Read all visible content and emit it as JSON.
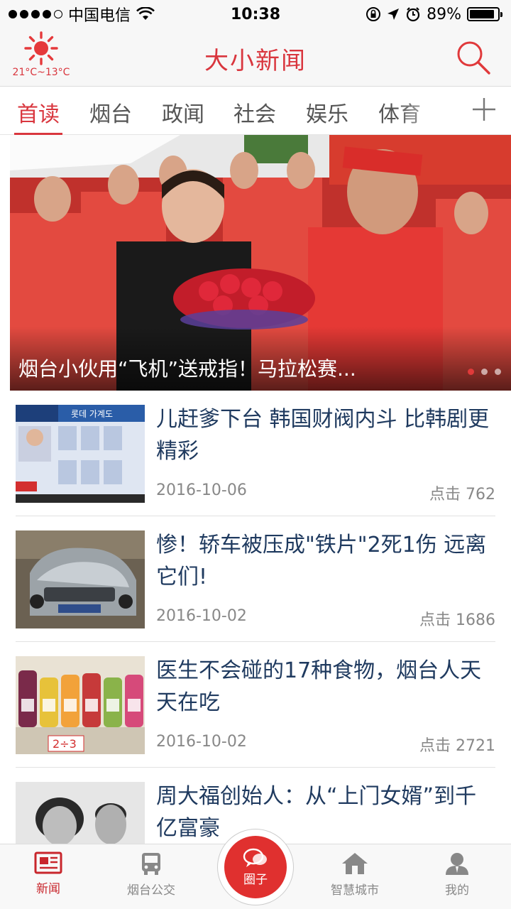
{
  "status_bar": {
    "carrier": "中国电信",
    "time": "10:38",
    "battery": "89%",
    "battery_level": 0.89
  },
  "header": {
    "title": "大小新闻",
    "weather_temp": "21°C~13°C"
  },
  "tabs": [
    {
      "label": "首读",
      "active": true
    },
    {
      "label": "烟台"
    },
    {
      "label": "政闻"
    },
    {
      "label": "社会"
    },
    {
      "label": "娱乐"
    },
    {
      "label": "体育"
    }
  ],
  "hero": {
    "caption": "烟台小伙用“飞机”送戒指！马拉松赛...",
    "slide_count": 3,
    "active_slide": 1
  },
  "news": [
    {
      "title": "儿赶爹下台 韩国财阀内斗 比韩剧更精彩",
      "date": "2016-10-06",
      "clicks": "点击 762",
      "thumb_text": "롯데 가계도"
    },
    {
      "title": "惨！轿车被压成\"铁片\"2死1伤 远离它们!",
      "date": "2016-10-02",
      "clicks": "点击 1686"
    },
    {
      "title": "医生不会碰的17种食物，烟台人天天在吃",
      "date": "2016-10-02",
      "clicks": "点击 2721",
      "thumb_text": "2÷3"
    },
    {
      "title": "周大福创始人：从“上门女婿”到千亿富豪",
      "date": "",
      "clicks": ""
    }
  ],
  "bottom_nav": {
    "news": "新闻",
    "bus": "烟台公交",
    "circle": "圈子",
    "city": "智慧城市",
    "me": "我的"
  },
  "colors": {
    "accent": "#d9363e",
    "title_blue": "#1f3a5f"
  }
}
